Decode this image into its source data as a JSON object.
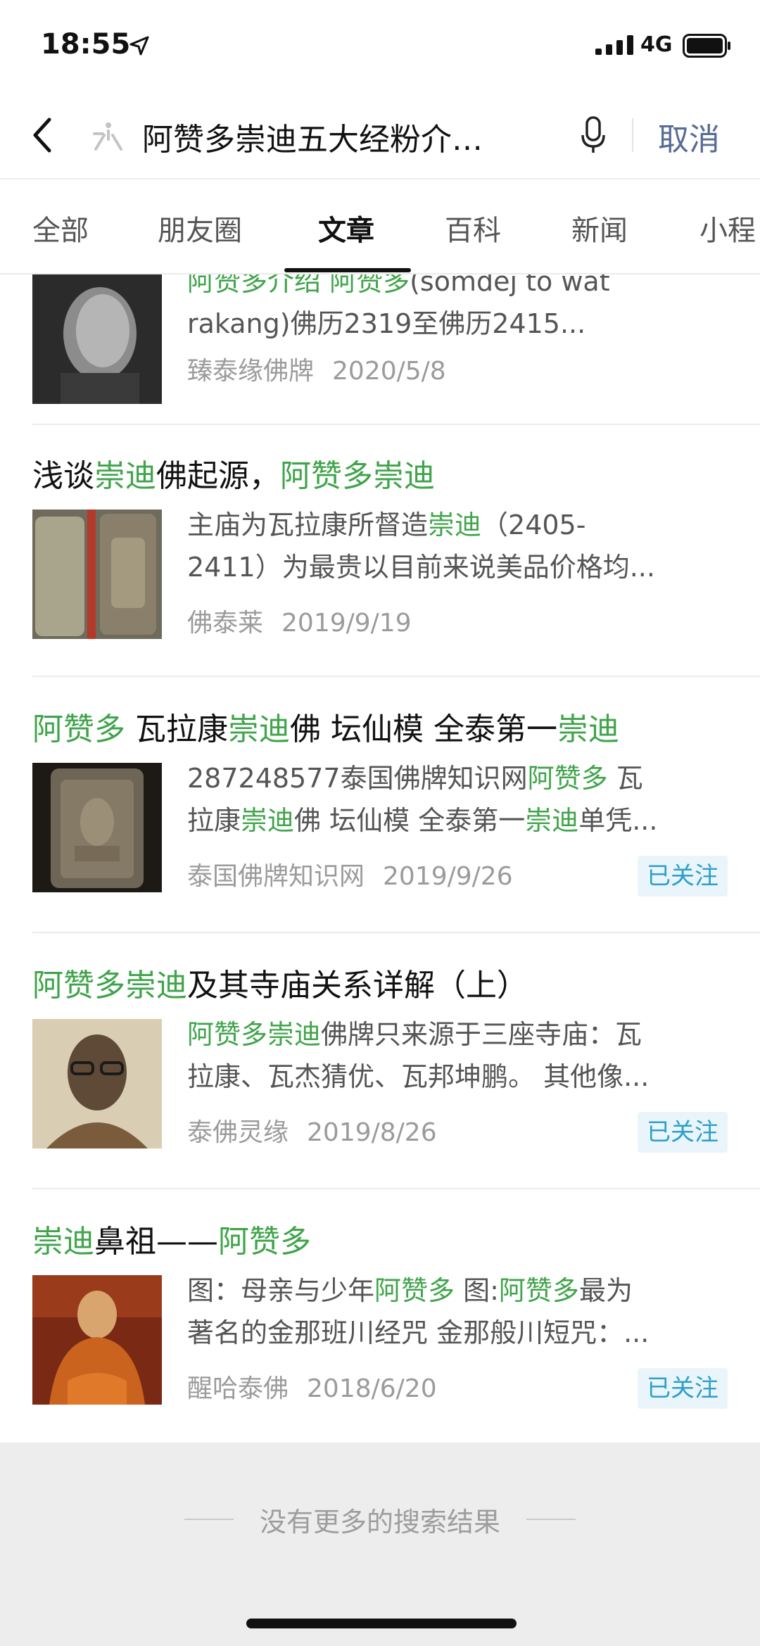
{
  "status_bar": {
    "time": "18:55",
    "network": "4G",
    "icons": [
      "location-arrow-icon",
      "signal-icon",
      "battery-icon"
    ]
  },
  "search": {
    "query": "阿赞多崇迪五大经粉介…",
    "cancel_label": "取消",
    "icons": [
      "back-icon",
      "search-logo-icon",
      "microphone-icon"
    ]
  },
  "tabs": [
    {
      "label": "全部",
      "active": false
    },
    {
      "label": "朋友圈",
      "active": false
    },
    {
      "label": "文章",
      "active": true
    },
    {
      "label": "百科",
      "active": false
    },
    {
      "label": "新闻",
      "active": false
    },
    {
      "label": "小程",
      "active": false
    }
  ],
  "highlight_color": "#3fa44a",
  "results": [
    {
      "title": [],
      "snippet_lines": [
        [
          {
            "t": "阿赞多介绍 阿赞多",
            "hl": true
          },
          {
            "t": "(somdej to wat",
            "hl": false
          }
        ],
        [
          {
            "t": "rakang)佛历2319至佛历2415...",
            "hl": false
          }
        ]
      ],
      "source": "臻泰缘佛牌",
      "date": "2020/5/8",
      "badge": ""
    },
    {
      "title": [
        {
          "t": "浅谈",
          "hl": false
        },
        {
          "t": "崇迪",
          "hl": true
        },
        {
          "t": "佛起源，",
          "hl": false
        },
        {
          "t": "阿赞多崇迪",
          "hl": true
        }
      ],
      "snippet_lines": [
        [
          {
            "t": "主庙为瓦拉康所督造",
            "hl": false
          },
          {
            "t": "崇迪",
            "hl": true
          },
          {
            "t": "（2405-",
            "hl": false
          }
        ],
        [
          {
            "t": "2411）为最贵以目前来说美品价格均...",
            "hl": false
          }
        ]
      ],
      "source": "佛泰莱",
      "date": "2019/9/19",
      "badge": ""
    },
    {
      "title": [
        {
          "t": "阿赞多",
          "hl": true
        },
        {
          "t": " 瓦拉康",
          "hl": false
        },
        {
          "t": "崇迪",
          "hl": true
        },
        {
          "t": "佛 坛仙模 全泰第一",
          "hl": false
        },
        {
          "t": "崇迪",
          "hl": true
        }
      ],
      "snippet_lines": [
        [
          {
            "t": "287248577泰国佛牌知识网",
            "hl": false
          },
          {
            "t": "阿赞多",
            "hl": true
          },
          {
            "t": " 瓦",
            "hl": false
          }
        ],
        [
          {
            "t": "拉康",
            "hl": false
          },
          {
            "t": "崇迪",
            "hl": true
          },
          {
            "t": "佛 坛仙模 全泰第一",
            "hl": false
          },
          {
            "t": "崇迪",
            "hl": true
          },
          {
            "t": "单凭...",
            "hl": false
          }
        ]
      ],
      "source": "泰国佛牌知识网",
      "date": "2019/9/26",
      "badge": "已关注"
    },
    {
      "title": [
        {
          "t": "阿赞多崇迪",
          "hl": true
        },
        {
          "t": "及其寺庙关系详解（上）",
          "hl": false
        }
      ],
      "snippet_lines": [
        [
          {
            "t": "阿赞多崇迪",
            "hl": true
          },
          {
            "t": "佛牌只来源于三座寺庙：瓦",
            "hl": false
          }
        ],
        [
          {
            "t": "拉康、瓦杰猜优、瓦邦坤鹏。 其他像...",
            "hl": false
          }
        ]
      ],
      "source": "泰佛灵缘",
      "date": "2019/8/26",
      "badge": "已关注"
    },
    {
      "title": [
        {
          "t": "崇迪",
          "hl": true
        },
        {
          "t": "鼻祖——",
          "hl": false
        },
        {
          "t": "阿赞多",
          "hl": true
        }
      ],
      "snippet_lines": [
        [
          {
            "t": "图：母亲与少年",
            "hl": false
          },
          {
            "t": "阿赞多",
            "hl": true
          },
          {
            "t": " 图:",
            "hl": false
          },
          {
            "t": "阿赞多",
            "hl": true
          },
          {
            "t": "最为",
            "hl": false
          }
        ],
        [
          {
            "t": "著名的金那班川经咒 金那般川短咒：...",
            "hl": false
          }
        ]
      ],
      "source": "醒哈泰佛",
      "date": "2018/6/20",
      "badge": "已关注"
    }
  ],
  "footer": {
    "text": "没有更多的搜索结果"
  }
}
